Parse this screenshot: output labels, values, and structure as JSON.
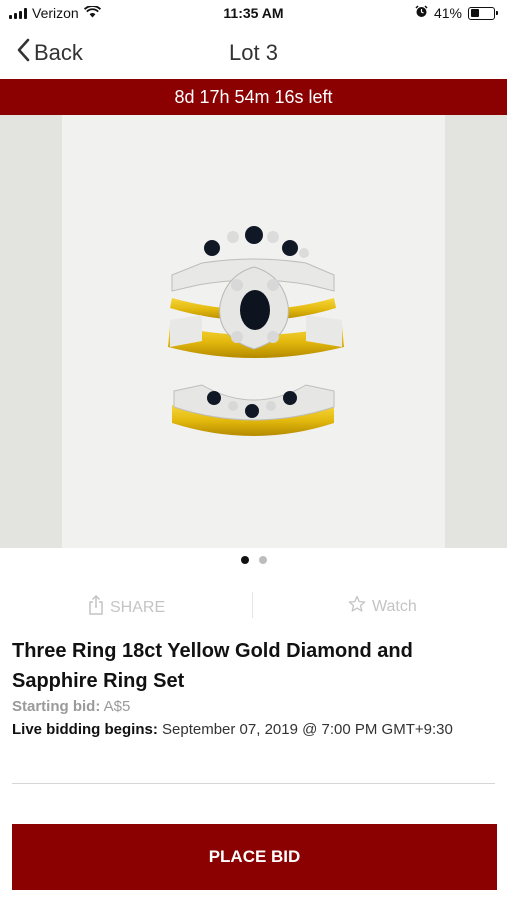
{
  "status_bar": {
    "carrier": "Verizon",
    "time": "11:35 AM",
    "battery_percent": "41%",
    "battery_level": 0.41,
    "icons": [
      "signal-icon",
      "wifi-icon",
      "alarm-icon",
      "battery-icon"
    ]
  },
  "nav": {
    "back_label": "Back",
    "title": "Lot 3"
  },
  "countdown": {
    "text": "8d 17h 54m 16s left"
  },
  "image": {
    "page_count": 2,
    "active_page": 1
  },
  "actions": {
    "share_label": "SHARE",
    "watch_label": "Watch"
  },
  "lot": {
    "title": "Three Ring 18ct Yellow Gold Diamond and Sapphire Ring Set",
    "starting_bid_label": "Starting bid:",
    "starting_bid_value": "A$5",
    "live_bidding_label": "Live bidding begins:",
    "live_bidding_value": "September 07, 2019 @ 7:00 PM GMT+9:30"
  },
  "cta": {
    "place_bid_label": "PLACE BID"
  },
  "colors": {
    "brand": "#8b0000",
    "muted": "#c4c4c4"
  }
}
